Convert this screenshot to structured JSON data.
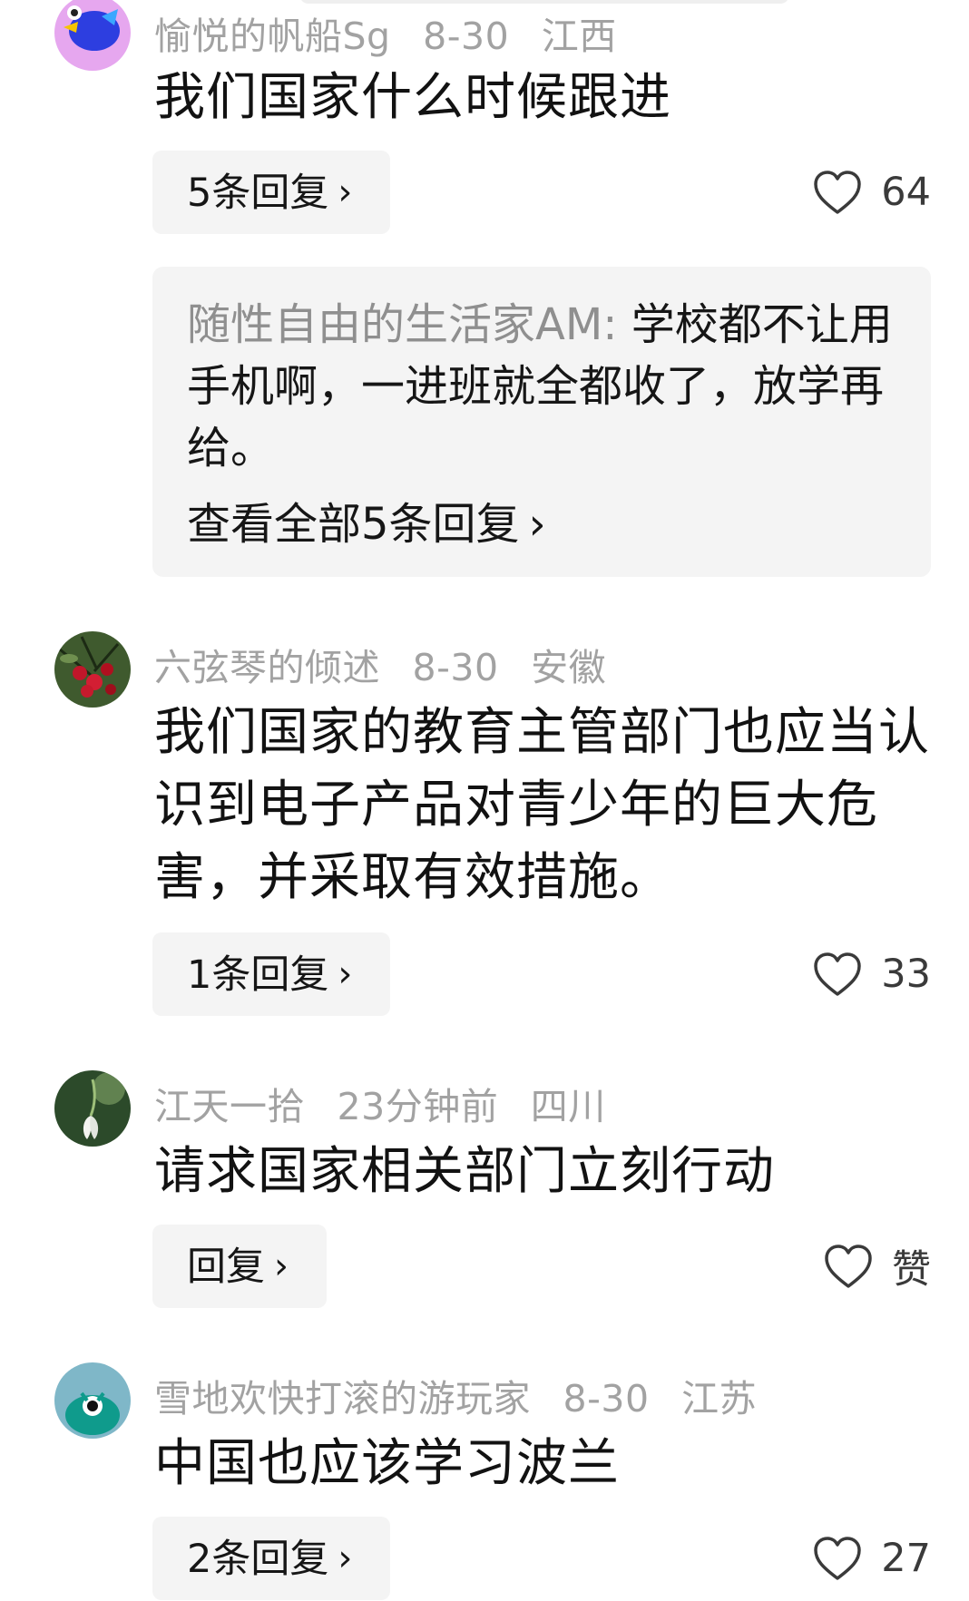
{
  "comments": [
    {
      "author": "愉悦的帆船Sg",
      "date": "8-30",
      "location": "江西",
      "text": "我们国家什么时候跟进",
      "reply_label": "5条回复",
      "likes": "64",
      "sub_reply": {
        "author": "随性自由的生活家AM:",
        "text": "学校都不让用手机啊，一进班就全都收了，放学再给。",
        "view_all": "查看全部5条回复"
      }
    },
    {
      "author": "六弦琴的倾述",
      "date": "8-30",
      "location": "安徽",
      "text": "我们国家的教育主管部门也应当认识到电子产品对青少年的巨大危害，并采取有效措施。",
      "reply_label": "1条回复",
      "likes": "33"
    },
    {
      "author": "江天一拾",
      "date": "23分钟前",
      "location": "四川",
      "text": "请求国家相关部门立刻行动",
      "reply_label": "回复",
      "likes": "赞"
    },
    {
      "author": "雪地欢快打滚的游玩家",
      "date": "8-30",
      "location": "江苏",
      "text": "中国也应该学习波兰",
      "reply_label": "2条回复",
      "likes": "27"
    }
  ],
  "icons": {
    "chevron": "chevron-right-icon",
    "like": "heart-outline-icon"
  },
  "colors": {
    "meta_gray": "#a2a2a2",
    "button_bg": "#f4f4f4",
    "text_dark": "#121212"
  }
}
